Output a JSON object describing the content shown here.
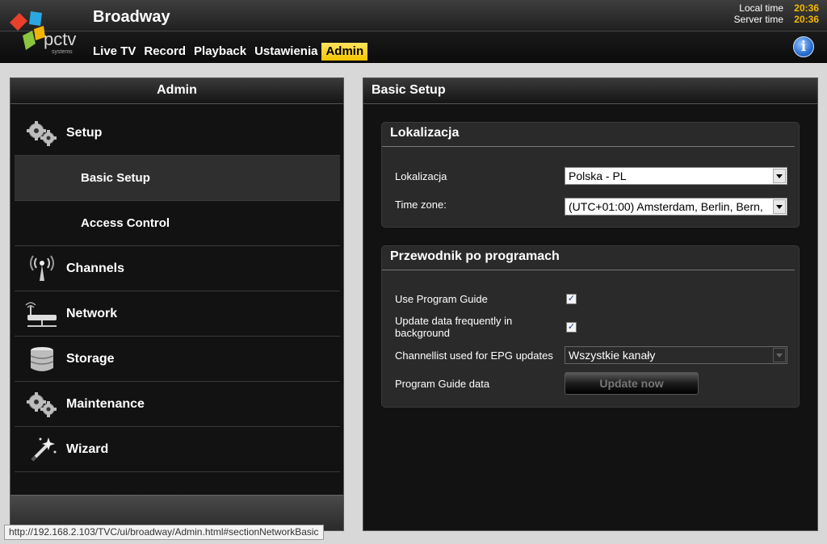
{
  "header": {
    "app_title": "Broadway",
    "logo_text": "pctv",
    "logo_sub": "systems",
    "local_time_label": "Local time",
    "local_time": "20:36",
    "server_time_label": "Server time",
    "server_time": "20:36"
  },
  "nav": [
    {
      "label": "Live TV"
    },
    {
      "label": "Record"
    },
    {
      "label": "Playback"
    },
    {
      "label": "Ustawienia"
    },
    {
      "label": "Admin"
    }
  ],
  "sidebar": {
    "title": "Admin",
    "items": [
      {
        "label": "Setup",
        "icon": "gears-icon"
      },
      {
        "label": "Basic Setup",
        "icon": ""
      },
      {
        "label": "Access Control",
        "icon": ""
      },
      {
        "label": "Channels",
        "icon": "antenna-icon"
      },
      {
        "label": "Network",
        "icon": "router-icon"
      },
      {
        "label": "Storage",
        "icon": "database-icon"
      },
      {
        "label": "Maintenance",
        "icon": "gears-icon"
      },
      {
        "label": "Wizard",
        "icon": "magic-wand-icon"
      }
    ]
  },
  "main": {
    "title": "Basic Setup",
    "localization": {
      "title": "Lokalizacja",
      "locale_label": "Lokalizacja",
      "locale_value": "Polska - PL",
      "timezone_label": "Time zone:",
      "timezone_value": "(UTC+01:00) Amsterdam, Berlin, Bern,"
    },
    "guide": {
      "title": "Przewodnik po programach",
      "use_guide_label": "Use Program Guide",
      "use_guide_checked": true,
      "update_bg_label": "Update data frequently in background",
      "update_bg_checked": true,
      "channellist_label": "Channellist used for EPG updates",
      "channellist_value": "Wszystkie kanały",
      "guide_data_label": "Program Guide data",
      "update_button": "Update now"
    }
  },
  "status_bar": {
    "url": "http://192.168.2.103/TVC/ui/broadway/Admin.html#sectionNetworkBasic"
  },
  "colors": {
    "accent": "#f4c400",
    "time": "#f5b800"
  }
}
